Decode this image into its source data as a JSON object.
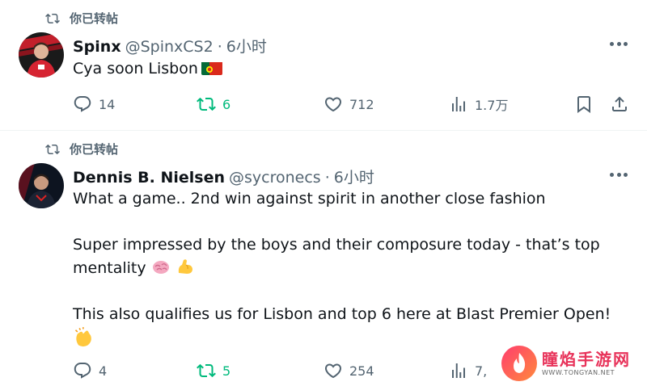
{
  "colors": {
    "accent_green": "#00ba7c",
    "muted": "#536471",
    "brand_red": "#e8335a"
  },
  "tweets": [
    {
      "retweet_label": "你已转帖",
      "name": "Spinx",
      "handle": "@SpinxCS2",
      "dot": "·",
      "time": "6小时",
      "text": [
        "Cya soon Lisbon"
      ],
      "flag_icon": "portugal-flag",
      "actions": {
        "reply": "14",
        "retweet": "6",
        "like": "712",
        "views": "1.7万"
      }
    },
    {
      "retweet_label": "你已转帖",
      "name": "Dennis B. Nielsen",
      "handle": "@sycronecs",
      "dot": "·",
      "time": "6小时",
      "text": [
        "What a game.. 2nd win against spirit in another close fashion",
        "Super impressed by the boys and their composure today - that’s top",
        "mentality",
        "This also qualifies us for Lisbon and top 6 here at Blast Premier Open!"
      ],
      "actions": {
        "reply": "4",
        "retweet": "5",
        "like": "254",
        "views": "7,"
      }
    }
  ],
  "watermark": {
    "title": "瞳焰手游网",
    "url": "WWW.TONGYAN.NET"
  }
}
